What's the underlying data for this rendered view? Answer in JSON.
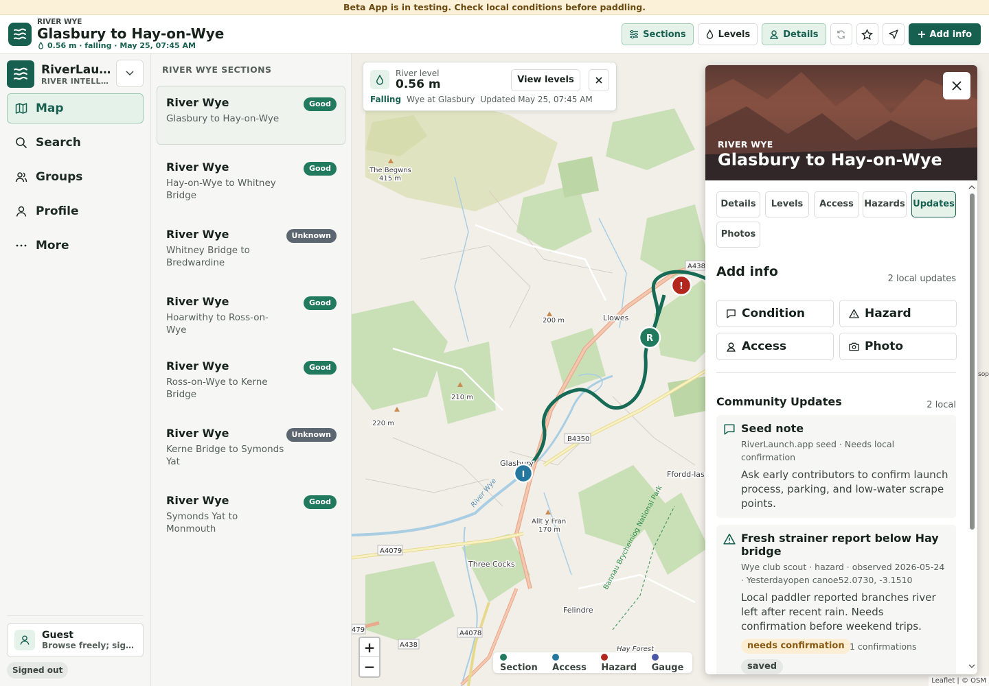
{
  "banner": {
    "text": "Beta App is in testing. Check local conditions before paddling."
  },
  "topbar": {
    "kicker": "RIVER WYE",
    "title": "Glasbury to Hay-on-Wye",
    "meta": "0.56 m · falling · May 25, 07:45 AM",
    "buttons": {
      "sections": "Sections",
      "levels": "Levels",
      "details": "Details",
      "add": "Add info"
    }
  },
  "sidebar": {
    "brand": "RiverLaunch",
    "brand_sub": "RIVER INTELLIGENCE",
    "nav": [
      {
        "label": "Map",
        "icon": "map-icon"
      },
      {
        "label": "Search",
        "icon": "search-icon"
      },
      {
        "label": "Groups",
        "icon": "groups-icon"
      },
      {
        "label": "Profile",
        "icon": "profile-icon"
      },
      {
        "label": "More",
        "icon": "more-icon"
      }
    ],
    "guest": {
      "name": "Guest",
      "sub": "Browse freely; sign in to contribute"
    },
    "status": "Signed out"
  },
  "sections": {
    "heading": "RIVER WYE SECTIONS",
    "items": [
      {
        "river": "River Wye",
        "name": "Glasbury to Hay-on-Wye",
        "status": "Good"
      },
      {
        "river": "River Wye",
        "name": "Hay-on-Wye to Whitney Bridge",
        "status": "Good"
      },
      {
        "river": "River Wye",
        "name": "Whitney Bridge to Bredwardine",
        "status": "Unknown"
      },
      {
        "river": "River Wye",
        "name": "Hoarwithy to Ross-on-Wye",
        "status": "Good"
      },
      {
        "river": "River Wye",
        "name": "Ross-on-Wye to Kerne Bridge",
        "status": "Good"
      },
      {
        "river": "River Wye",
        "name": "Kerne Bridge to Symonds Yat",
        "status": "Unknown"
      },
      {
        "river": "River Wye",
        "name": "Symonds Yat to Monmouth",
        "status": "Good"
      }
    ]
  },
  "map": {
    "level_card": {
      "label": "River level",
      "value": "0.56 m",
      "view": "View levels",
      "trend": "Falling",
      "gauge": "Wye at Glasbury",
      "updated": "Updated May 25, 07:45 AM"
    },
    "labels": {
      "begwns": "The Begwns",
      "begwns_h": "415 m",
      "llowes": "Llowes",
      "h200": "200 m",
      "h210": "210 m",
      "h220": "220 m",
      "glasbury": "Glasbury",
      "ffordd": "Ffordd-las",
      "allt": "Allt y Fran",
      "allt_h": "170 m",
      "three_cocks": "Three Cocks",
      "felindre": "Felindre",
      "hay_forest": "Hay Forest",
      "park": "Bannau Brycheiniog National Park",
      "river": "River Wye",
      "a438": "A438",
      "a438b": "A438",
      "b4350": "B4350",
      "a4079": "A4079",
      "a4078": "A4078",
      "a479": "479",
      "edge": "sop ill m"
    },
    "markers": {
      "hazard": "!",
      "rapid": "R",
      "info": "I"
    },
    "zoom": {
      "in": "+",
      "out": "−"
    },
    "legend": [
      {
        "label": "Section",
        "color": "#217a5e"
      },
      {
        "label": "Access",
        "color": "#2577a0"
      },
      {
        "label": "Hazard",
        "color": "#b3261e"
      },
      {
        "label": "Gauge",
        "color": "#4a55a6"
      }
    ],
    "attribution": "Leaflet | © OSM"
  },
  "detail": {
    "kicker": "RIVER WYE",
    "title": "Glasbury to Hay-on-Wye",
    "tabs": [
      "Details",
      "Levels",
      "Access",
      "Hazards",
      "Updates",
      "Photos"
    ],
    "add_info": {
      "title": "Add info",
      "count": "2 local updates",
      "buttons": [
        "Condition",
        "Hazard",
        "Access",
        "Photo"
      ]
    },
    "community": {
      "title": "Community Updates",
      "count": "2 local",
      "items": [
        {
          "title": "Seed note",
          "meta": "RiverLaunch.app seed · Needs local confirmation",
          "body": "Ask early contributors to confirm launch process, parking, and low-water scrape points."
        },
        {
          "title": "Fresh strainer report below Hay bridge",
          "meta": "Wye club scout · hazard · observed 2026-05-24 · Yesterdayopen canoe52.0730, -3.1510",
          "body": "Local paddler reported branches river left after recent rain. Needs confirmation before weekend trips.",
          "chip": "needs confirmation",
          "confirmations": "1 confirmations",
          "saved": "saved"
        }
      ]
    }
  },
  "colors": {
    "brand": "#176050",
    "good": "#217a5e",
    "unknown": "#5b6670",
    "hazard": "#b3261e",
    "access": "#2577a0"
  }
}
